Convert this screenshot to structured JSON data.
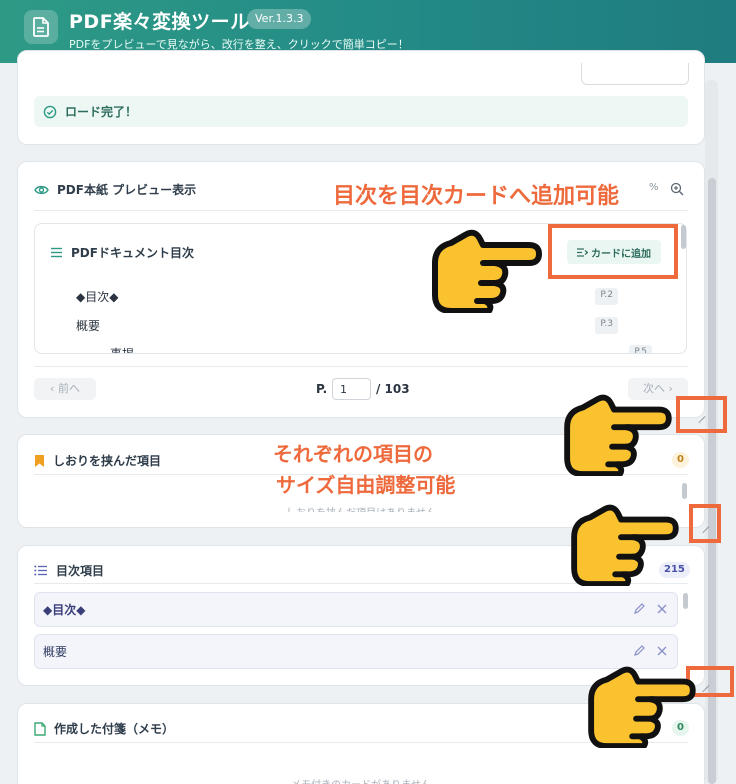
{
  "header": {
    "title": "PDF楽々変換ツール",
    "version": "Ver.1.3.3",
    "subtitle": "PDFをプレビューで見ながら、改行を整え、クリックで簡単コピー！"
  },
  "load_card": {
    "status_text": "ロード完了！"
  },
  "preview_card": {
    "title": "PDF本紙 プレビュー表示",
    "zoom_partial": "%",
    "toc_panel": {
      "title": "PDFドキュメント目次",
      "add_button": "カードに追加",
      "rows": [
        {
          "label": "◆目次◆",
          "page": "P.2"
        },
        {
          "label": "概要",
          "page": "P.3"
        },
        {
          "label": "事掲",
          "page": "P.5"
        }
      ]
    },
    "pager": {
      "prev_label": "前へ",
      "page_prefix": "P.",
      "page_value": "1",
      "page_total": "/ 103",
      "next_label": "次へ"
    }
  },
  "bookmark_card": {
    "title": "しおりを挟んだ項目",
    "count": "0",
    "empty_text": "しおりを挟んだ項目はありません"
  },
  "toc_card": {
    "title": "目次項目",
    "count": "215",
    "items": [
      {
        "label": "◆目次◆"
      },
      {
        "label": "概要"
      }
    ]
  },
  "memo_card": {
    "title": "作成した付箋（メモ）",
    "count": "0",
    "empty_text": "メモ付きのカードがありません"
  },
  "annotations": {
    "toc_note": "目次を目次カードへ追加可能",
    "resize_note_line1": "それぞれの項目の",
    "resize_note_line2": "サイズ自由調整可能"
  },
  "colors": {
    "header_start": "#2e9a86",
    "header_end": "#1f7c80",
    "accent_orange": "#ee6a3c",
    "hand_yellow": "#f9c22e"
  }
}
